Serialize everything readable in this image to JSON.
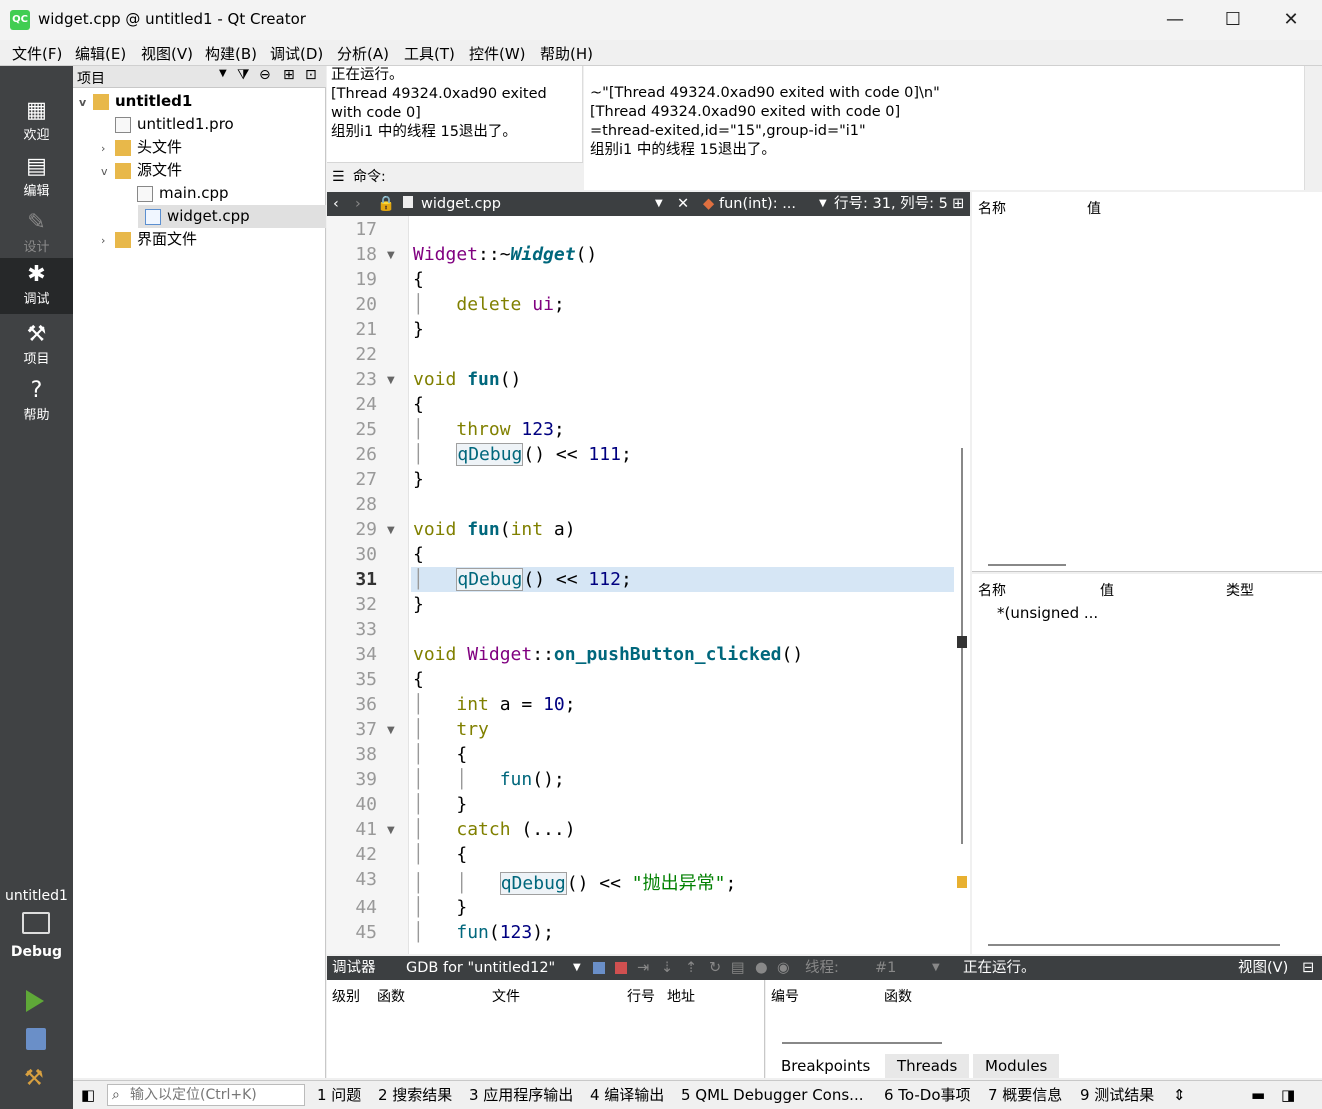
{
  "window": {
    "title": "widget.cpp @ untitled1 - Qt Creator",
    "logo": "QC",
    "minimize": "—",
    "maximize": "☐",
    "close": "✕"
  },
  "menu": [
    "文件(F)",
    "编辑(E)",
    "视图(V)",
    "构建(B)",
    "调试(D)",
    "分析(A)",
    "工具(T)",
    "控件(W)",
    "帮助(H)"
  ],
  "modes": [
    {
      "label": "欢迎",
      "icon": "grid-icon"
    },
    {
      "label": "编辑",
      "icon": "document-icon"
    },
    {
      "label": "设计",
      "icon": "pencil-icon"
    },
    {
      "label": "调试",
      "icon": "bug-icon"
    },
    {
      "label": "项目",
      "icon": "wrench-icon"
    },
    {
      "label": "帮助",
      "icon": "help-icon"
    }
  ],
  "kit": {
    "project": "untitled1",
    "config": "Debug"
  },
  "projects": {
    "header": "项目",
    "tree": [
      {
        "label": "untitled1",
        "level": 0,
        "expanded": true
      },
      {
        "label": "untitled1.pro",
        "level": 1
      },
      {
        "label": "头文件",
        "level": 1,
        "expanded": false
      },
      {
        "label": "源文件",
        "level": 1,
        "expanded": true
      },
      {
        "label": "main.cpp",
        "level": 2
      },
      {
        "label": "widget.cpp",
        "level": 2,
        "selected": true
      },
      {
        "label": "界面文件",
        "level": 1,
        "expanded": false
      }
    ]
  },
  "app_output": [
    "正在运行。",
    "[Thread 49324.0xad90 exited",
    "with code 0]",
    "组别i1 中的线程 15退出了。"
  ],
  "command_label": "命令:",
  "debugger_log": [
    "~\"[Thread 49324.0xad90 exited with code 0]\\n\"",
    "[Thread 49324.0xad90 exited with code 0]",
    "=thread-exited,id=\"15\",group-id=\"i1\"",
    "组别i1 中的线程 15退出了。"
  ],
  "editor": {
    "file": "widget.cpp",
    "function": "fun(int): ...",
    "position": "行号: 31, 列号: 5",
    "current_line": 31,
    "lines": [
      17,
      18,
      19,
      20,
      21,
      22,
      23,
      24,
      25,
      26,
      27,
      28,
      29,
      30,
      31,
      32,
      33,
      34,
      35,
      36,
      37,
      38,
      39,
      40,
      41,
      42,
      43,
      44,
      45
    ]
  },
  "locals": {
    "col_name": "名称",
    "col_value": "值"
  },
  "expressions": {
    "col_name": "名称",
    "col_value": "值",
    "col_type": "类型",
    "row": "*(unsigned ..."
  },
  "debug_toolbar": {
    "label": "调试器",
    "engine": "GDB for \"untitled12\"",
    "thread_label": "线程:",
    "thread": "#1",
    "status": "正在运行。",
    "view": "视图(V)"
  },
  "stack": {
    "col_level": "级别",
    "col_function": "函数",
    "col_file": "文件",
    "col_line": "行号",
    "col_address": "地址"
  },
  "breakpoints": {
    "col_number": "编号",
    "col_function": "函数",
    "tabs": [
      "Breakpoints",
      "Threads",
      "Modules"
    ]
  },
  "status": {
    "locator_placeholder": "输入以定位(Ctrl+K)",
    "tabs": [
      "1 问题",
      "2 搜索结果",
      "3 应用程序输出",
      "4 编译输出",
      "5 QML Debugger Cons...",
      "6 To-Do事项",
      "7 概要信息",
      "9 测试结果"
    ]
  }
}
